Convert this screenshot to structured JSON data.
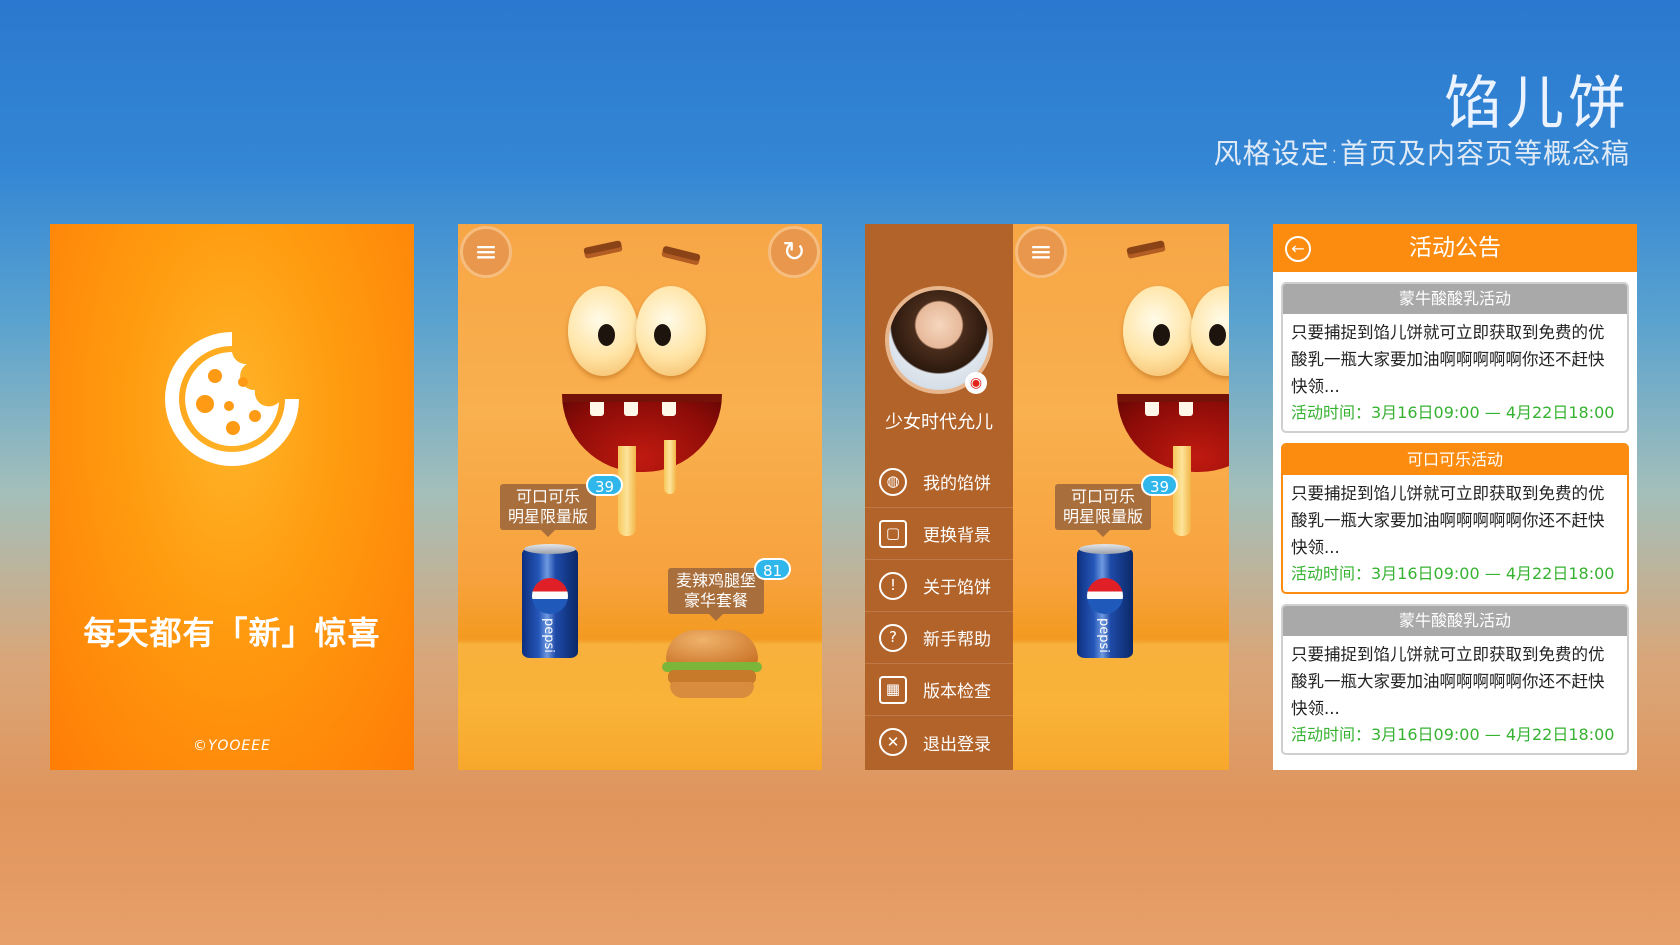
{
  "header": {
    "title": "馅儿饼",
    "subtitle": "风格设定:首页及内容页等概念稿"
  },
  "splash": {
    "slogan": "每天都有「新」惊喜",
    "brand": "©YOOEEE",
    "logo_icon": "cookie-icon",
    "accent": "#ff8a0a"
  },
  "game": {
    "menu_icon": "≡",
    "refresh_icon": "↻",
    "items": [
      {
        "label_line1": "可口可乐",
        "label_line2": "明星限量版",
        "count": "39"
      },
      {
        "label_line1": "麦辣鸡腿堡",
        "label_line2": "豪华套餐",
        "count": "81"
      }
    ],
    "pepsi_text": "pepsi"
  },
  "drawer": {
    "username": "少女时代允儿",
    "menu": [
      {
        "icon": "cookie-icon",
        "glyph": "◍",
        "label": "我的馅饼"
      },
      {
        "icon": "background-icon",
        "glyph": "▢",
        "label": "更换背景"
      },
      {
        "icon": "info-icon",
        "glyph": "!",
        "label": "关于馅饼"
      },
      {
        "icon": "help-icon",
        "glyph": "?",
        "label": "新手帮助"
      },
      {
        "icon": "calendar-icon",
        "glyph": "▦",
        "label": "版本检查"
      },
      {
        "icon": "logout-icon",
        "glyph": "✕",
        "label": "退出登录"
      }
    ]
  },
  "announce": {
    "title": "活动公告",
    "back_glyph": "←",
    "cards": [
      {
        "title": "蒙牛酸酸乳活动",
        "body": "只要捕捉到馅儿饼就可立即获取到免费的优酸乳一瓶大家要加油啊啊啊啊啊你还不赶快快领...",
        "time": "活动时间：3月16日09:00 — 4月22日18:00"
      },
      {
        "title": "可口可乐活动",
        "body": "只要捕捉到馅儿饼就可立即获取到免费的优酸乳一瓶大家要加油啊啊啊啊啊你还不赶快快领...",
        "time": "活动时间：3月16日09:00 — 4月22日18:00"
      },
      {
        "title": "蒙牛酸酸乳活动",
        "body": "只要捕捉到馅儿饼就可立即获取到免费的优酸乳一瓶大家要加油啊啊啊啊啊你还不赶快快领...",
        "time": "活动时间：3月16日09:00 — 4月22日18:00"
      }
    ]
  }
}
